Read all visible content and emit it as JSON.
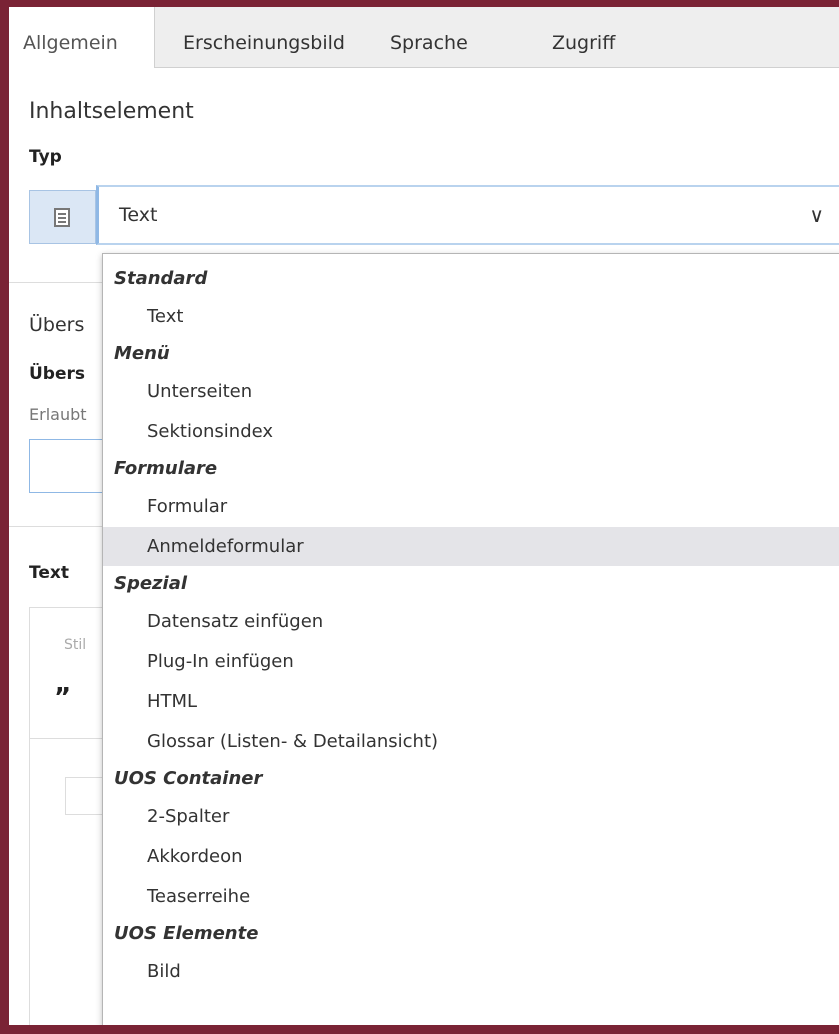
{
  "tabs": [
    {
      "label": "Allgemein",
      "active": true
    },
    {
      "label": "Erscheinungsbild",
      "active": false
    },
    {
      "label": "Sprache",
      "active": false
    },
    {
      "label": "Zugriff",
      "active": false
    }
  ],
  "content_section": {
    "title": "Inhaltselement",
    "type_label": "Typ",
    "type_icon": "document-text-icon",
    "type_value": "Text"
  },
  "background": {
    "header_section_title_partial": "Übers",
    "header_field_label_partial": "Übers",
    "allowed_hint_partial": "Erlaubt",
    "text_label": "Text",
    "editor_style_partial": "Stil",
    "quote_glyph": "”"
  },
  "dropdown": {
    "highlight_color": "#e4e4e8",
    "groups": [
      {
        "label": "Standard",
        "options": [
          "Text"
        ]
      },
      {
        "label": "Menü",
        "options": [
          "Unterseiten",
          "Sektionsindex"
        ]
      },
      {
        "label": "Formulare",
        "options": [
          "Formular",
          "Anmeldeformular"
        ]
      },
      {
        "label": "Spezial",
        "options": [
          "Datensatz einfügen",
          "Plug-In einfügen",
          "HTML",
          "Glossar (Listen- & Detailansicht)"
        ]
      },
      {
        "label": "UOS Container",
        "options": [
          "2-Spalter",
          "Akkordeon",
          "Teaserreihe"
        ]
      },
      {
        "label": "UOS Elemente",
        "options": [
          "Bild"
        ]
      }
    ],
    "highlighted_option": "Anmeldeformular"
  },
  "colors": {
    "frame": "#7a2335",
    "select_border": "#b9d3ee",
    "addon_bg": "#dbe7f5"
  }
}
